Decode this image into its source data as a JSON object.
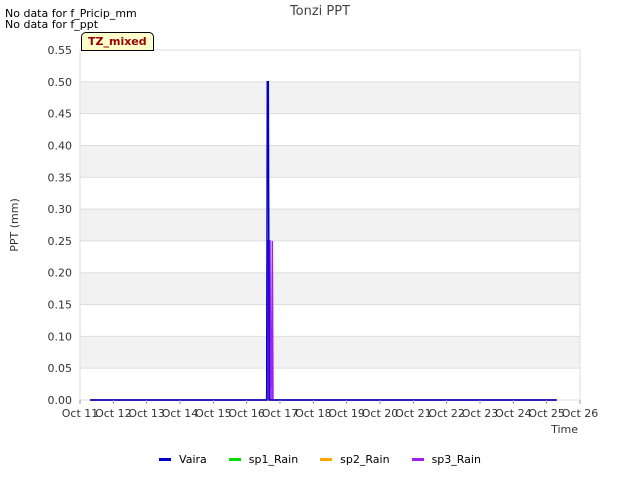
{
  "notices": [
    "No data for f_Pricip_mm",
    "No data for f_ppt"
  ],
  "badge": "TZ_mixed",
  "chart_data": {
    "type": "line",
    "title": "Tonzi PPT",
    "xlabel": "Time",
    "ylabel": "PPT (mm)",
    "ylim": [
      0,
      0.55
    ],
    "yticks": [
      "0.00",
      "0.05",
      "0.10",
      "0.15",
      "0.20",
      "0.25",
      "0.30",
      "0.35",
      "0.40",
      "0.45",
      "0.50",
      "0.55"
    ],
    "xticks": [
      "Oct 11",
      "Oct 12",
      "Oct 13",
      "Oct 14",
      "Oct 15",
      "Oct 16",
      "Oct 17",
      "Oct 18",
      "Oct 19",
      "Oct 20",
      "Oct 21",
      "Oct 22",
      "Oct 23",
      "Oct 24",
      "Oct 25",
      "Oct 26"
    ],
    "xlim_days": [
      11,
      26
    ],
    "grid": true,
    "legend_position": "bottom",
    "series": [
      {
        "name": "Vaira",
        "color": "#0000cc",
        "x": [
          11.3,
          16.6,
          16.62,
          16.65,
          16.68,
          25.3
        ],
        "y": [
          0,
          0,
          0.5,
          0.5,
          0,
          0
        ]
      },
      {
        "name": "sp1_Rain",
        "color": "#00dd00",
        "x": [
          11.3,
          25.3
        ],
        "y": [
          0,
          0
        ]
      },
      {
        "name": "sp2_Rain",
        "color": "#ffa500",
        "x": [
          11.3,
          25.3
        ],
        "y": [
          0,
          0
        ]
      },
      {
        "name": "sp3_Rain",
        "color": "#a020f0",
        "x": [
          11.3,
          16.6,
          16.62,
          16.7,
          16.72,
          16.75,
          16.77,
          16.79,
          25.3
        ],
        "y": [
          0,
          0,
          0.25,
          0.25,
          0.02,
          0.02,
          0.25,
          0,
          0
        ]
      }
    ]
  }
}
